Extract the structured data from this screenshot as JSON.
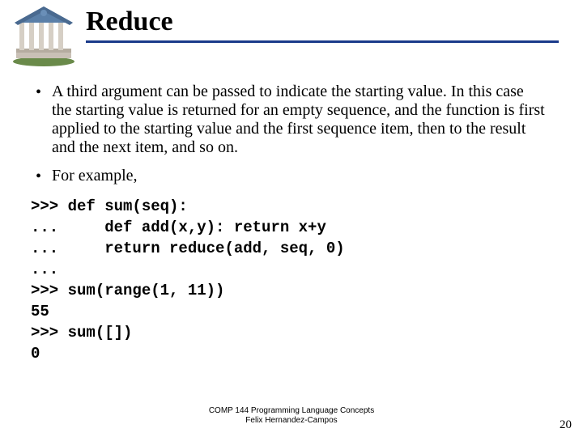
{
  "title": "Reduce",
  "bullets": [
    "A third argument can be passed to indicate the starting value. In this case the starting value is returned for an empty sequence, and the function is first applied to the starting value and the first sequence item, then to the result and the next item, and so on.",
    "For example,"
  ],
  "code": ">>> def sum(seq):\n...     def add(x,y): return x+y\n...     return reduce(add, seq, 0)\n... \n>>> sum(range(1, 11))\n55\n>>> sum([])\n0",
  "footer_line1": "COMP 144 Programming Language Concepts",
  "footer_line2": "Felix Hernandez-Campos",
  "page_number": "20"
}
